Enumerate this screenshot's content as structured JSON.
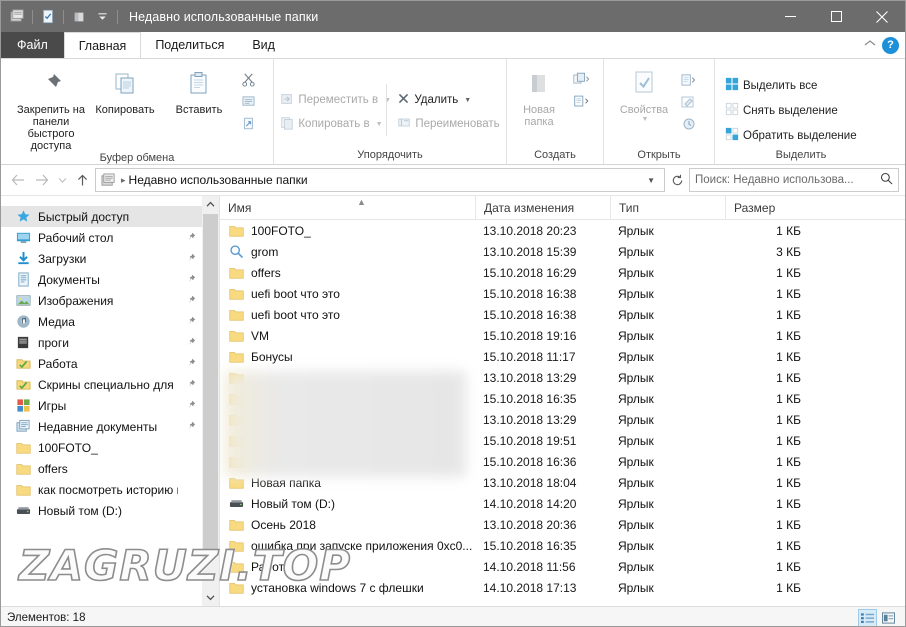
{
  "window": {
    "title": "Недавно использованные папки",
    "quick_access_icons": [
      "explorer-icon",
      "properties-icon",
      "new-folder-icon",
      "customize-qat-icon"
    ],
    "controls": {
      "minimize": "minimize-icon",
      "maximize": "maximize-icon",
      "close": "close-icon"
    }
  },
  "tabs": [
    {
      "label": "Файл",
      "name": "tab-file"
    },
    {
      "label": "Главная",
      "name": "tab-home"
    },
    {
      "label": "Поделиться",
      "name": "tab-share"
    },
    {
      "label": "Вид",
      "name": "tab-view"
    }
  ],
  "ribbon": {
    "collapse_icon": "chevron-up-icon",
    "help_label": "?",
    "groups": [
      {
        "title": "Буфер обмена",
        "big": [
          {
            "label": "Закрепить на панели быстрого доступа",
            "icon": "pin-icon"
          },
          {
            "label": "Копировать",
            "icon": "copy-icon"
          },
          {
            "label": "Вставить",
            "icon": "paste-icon"
          }
        ],
        "mini": [
          "cut-icon",
          "copy-path-icon",
          "paste-shortcut-icon"
        ]
      },
      {
        "title": "Упорядочить",
        "items": [
          {
            "label": "Переместить в",
            "icon": "move-to-icon",
            "caret": true,
            "dim": true
          },
          {
            "label": "Копировать в",
            "icon": "copy-to-icon",
            "caret": true,
            "dim": true
          },
          {
            "label": "Удалить",
            "icon": "delete-icon",
            "caret": true,
            "dim": false
          },
          {
            "label": "Переименовать",
            "icon": "rename-icon",
            "caret": false,
            "dim": true
          }
        ]
      },
      {
        "title": "Создать",
        "big": [
          {
            "label": "Новая папка",
            "icon": "new-folder-icon"
          }
        ],
        "mini": [
          "new-item-icon",
          "easy-access-icon"
        ]
      },
      {
        "title": "Открыть",
        "big": [
          {
            "label": "Свойства",
            "icon": "properties-icon"
          }
        ],
        "mini": [
          "open-icon",
          "edit-icon",
          "history-icon"
        ]
      },
      {
        "title": "Выделить",
        "items": [
          {
            "label": "Выделить все",
            "icon": "select-all-icon"
          },
          {
            "label": "Снять выделение",
            "icon": "select-none-icon"
          },
          {
            "label": "Обратить выделение",
            "icon": "invert-selection-icon"
          }
        ]
      }
    ]
  },
  "addressbar": {
    "back_icon": "arrow-left-icon",
    "forward_icon": "arrow-right-icon",
    "recent_icon": "chevron-down-icon",
    "up_icon": "arrow-up-icon",
    "crumb_icon": "recent-folders-icon",
    "path": "Недавно использованные папки",
    "dropdown_icon": "chevron-down-icon",
    "refresh_icon": "refresh-icon",
    "search_placeholder": "Поиск: Недавно использова...",
    "search_icon": "search-icon"
  },
  "sidebar": {
    "items": [
      {
        "label": "Быстрый доступ",
        "icon": "star-icon",
        "selected": true,
        "pinned": false
      },
      {
        "label": "Рабочий стол",
        "icon": "desktop-icon",
        "selected": false,
        "pinned": true
      },
      {
        "label": "Загрузки",
        "icon": "downloads-icon",
        "selected": false,
        "pinned": true
      },
      {
        "label": "Документы",
        "icon": "documents-icon",
        "selected": false,
        "pinned": true
      },
      {
        "label": "Изображения",
        "icon": "pictures-icon",
        "selected": false,
        "pinned": true
      },
      {
        "label": "Медиа",
        "icon": "media-icon",
        "selected": false,
        "pinned": true
      },
      {
        "label": "проги",
        "icon": "folder-dark-icon",
        "selected": false,
        "pinned": true
      },
      {
        "label": "Работа",
        "icon": "folder-check-icon",
        "selected": false,
        "pinned": true
      },
      {
        "label": "Скрины специально для",
        "icon": "folder-check-icon",
        "selected": false,
        "pinned": true
      },
      {
        "label": "Игры",
        "icon": "games-icon",
        "selected": false,
        "pinned": true
      },
      {
        "label": "Недавние документы",
        "icon": "recent-folders-icon",
        "selected": false,
        "pinned": true
      },
      {
        "label": "100FOTO_",
        "icon": "folder-icon",
        "selected": false,
        "pinned": false
      },
      {
        "label": "offers",
        "icon": "folder-icon",
        "selected": false,
        "pinned": false
      },
      {
        "label": "как посмотреть историю на",
        "icon": "folder-icon",
        "selected": false,
        "pinned": false
      },
      {
        "label": "Новый том (D:)",
        "icon": "drive-icon",
        "selected": false,
        "pinned": false
      }
    ],
    "scroll_up_icon": "chevron-up-icon",
    "scroll_down_icon": "chevron-down-icon"
  },
  "filelist": {
    "columns": [
      {
        "label": "Имя",
        "name": "column-name"
      },
      {
        "label": "Дата изменения",
        "name": "column-date"
      },
      {
        "label": "Тип",
        "name": "column-type"
      },
      {
        "label": "Размер",
        "name": "column-size"
      }
    ],
    "sort_indicator": "sort-ascending-icon",
    "rows": [
      {
        "name": "100FOTO_",
        "icon": "folder-icon",
        "date": "13.10.2018 20:23",
        "type": "Ярлык",
        "size": "1 КБ",
        "blurred": false
      },
      {
        "name": "grom",
        "icon": "search-icon",
        "date": "13.10.2018 15:39",
        "type": "Ярлык",
        "size": "3 КБ",
        "blurred": false
      },
      {
        "name": "offers",
        "icon": "folder-icon",
        "date": "15.10.2018 16:29",
        "type": "Ярлык",
        "size": "1 КБ",
        "blurred": false
      },
      {
        "name": "uefi boot что это",
        "icon": "folder-icon",
        "date": "15.10.2018 16:38",
        "type": "Ярлык",
        "size": "1 КБ",
        "blurred": false
      },
      {
        "name": "uefi boot что это",
        "icon": "folder-icon",
        "date": "15.10.2018 16:38",
        "type": "Ярлык",
        "size": "1 КБ",
        "blurred": false
      },
      {
        "name": "VM",
        "icon": "folder-icon",
        "date": "15.10.2018 19:16",
        "type": "Ярлык",
        "size": "1 КБ",
        "blurred": false
      },
      {
        "name": "Бонусы",
        "icon": "folder-icon",
        "date": "15.10.2018 11:17",
        "type": "Ярлык",
        "size": "1 КБ",
        "blurred": false
      },
      {
        "name": "",
        "icon": "folder-icon",
        "date": "13.10.2018 13:29",
        "type": "Ярлык",
        "size": "1 КБ",
        "blurred": true
      },
      {
        "name": "",
        "icon": "folder-icon",
        "date": "15.10.2018 16:35",
        "type": "Ярлык",
        "size": "1 КБ",
        "blurred": true
      },
      {
        "name": "",
        "icon": "folder-icon",
        "date": "13.10.2018 13:29",
        "type": "Ярлык",
        "size": "1 КБ",
        "blurred": true
      },
      {
        "name": "",
        "icon": "folder-icon",
        "date": "15.10.2018 19:51",
        "type": "Ярлык",
        "size": "1 КБ",
        "blurred": true
      },
      {
        "name": "",
        "icon": "folder-icon",
        "date": "15.10.2018 16:36",
        "type": "Ярлык",
        "size": "1 КБ",
        "blurred": true
      },
      {
        "name": "Новая папка",
        "icon": "folder-icon",
        "date": "13.10.2018 18:04",
        "type": "Ярлык",
        "size": "1 КБ",
        "blurred": false
      },
      {
        "name": "Новый том (D:)",
        "icon": "drive-icon",
        "date": "14.10.2018 14:20",
        "type": "Ярлык",
        "size": "1 КБ",
        "blurred": false
      },
      {
        "name": "Осень 2018",
        "icon": "folder-icon",
        "date": "13.10.2018 20:36",
        "type": "Ярлык",
        "size": "1 КБ",
        "blurred": false
      },
      {
        "name": "ошибка при запуске приложения 0xc0...",
        "icon": "folder-icon",
        "date": "15.10.2018 16:35",
        "type": "Ярлык",
        "size": "1 КБ",
        "blurred": false
      },
      {
        "name": "Работа",
        "icon": "folder-icon",
        "date": "14.10.2018 11:56",
        "type": "Ярлык",
        "size": "1 КБ",
        "blurred": false
      },
      {
        "name": "установка windows 7 с флешки",
        "icon": "folder-icon",
        "date": "14.10.2018 17:13",
        "type": "Ярлык",
        "size": "1 КБ",
        "blurred": false
      }
    ]
  },
  "statusbar": {
    "count_text": "Элементов: 18",
    "view_details_icon": "details-view-icon",
    "view_tiles_icon": "tiles-view-icon"
  },
  "watermark": {
    "text": "ZAGRUZI.TOP"
  },
  "colors": {
    "titlebar": "#6c6c6c",
    "accent": "#1e90d8",
    "folder": "#f7d87a",
    "selection": "#e5e5e5"
  }
}
